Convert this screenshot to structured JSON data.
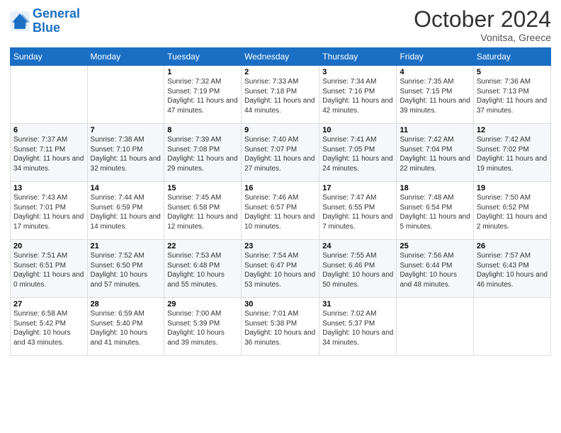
{
  "logo": {
    "text_general": "General",
    "text_blue": "Blue"
  },
  "header": {
    "month": "October 2024",
    "location": "Vonitsa, Greece"
  },
  "weekdays": [
    "Sunday",
    "Monday",
    "Tuesday",
    "Wednesday",
    "Thursday",
    "Friday",
    "Saturday"
  ],
  "weeks": [
    [
      {
        "day": "",
        "sunrise": "",
        "sunset": "",
        "daylight": ""
      },
      {
        "day": "",
        "sunrise": "",
        "sunset": "",
        "daylight": ""
      },
      {
        "day": "1",
        "sunrise": "Sunrise: 7:32 AM",
        "sunset": "Sunset: 7:19 PM",
        "daylight": "Daylight: 11 hours and 47 minutes."
      },
      {
        "day": "2",
        "sunrise": "Sunrise: 7:33 AM",
        "sunset": "Sunset: 7:18 PM",
        "daylight": "Daylight: 11 hours and 44 minutes."
      },
      {
        "day": "3",
        "sunrise": "Sunrise: 7:34 AM",
        "sunset": "Sunset: 7:16 PM",
        "daylight": "Daylight: 11 hours and 42 minutes."
      },
      {
        "day": "4",
        "sunrise": "Sunrise: 7:35 AM",
        "sunset": "Sunset: 7:15 PM",
        "daylight": "Daylight: 11 hours and 39 minutes."
      },
      {
        "day": "5",
        "sunrise": "Sunrise: 7:36 AM",
        "sunset": "Sunset: 7:13 PM",
        "daylight": "Daylight: 11 hours and 37 minutes."
      }
    ],
    [
      {
        "day": "6",
        "sunrise": "Sunrise: 7:37 AM",
        "sunset": "Sunset: 7:11 PM",
        "daylight": "Daylight: 11 hours and 34 minutes."
      },
      {
        "day": "7",
        "sunrise": "Sunrise: 7:38 AM",
        "sunset": "Sunset: 7:10 PM",
        "daylight": "Daylight: 11 hours and 32 minutes."
      },
      {
        "day": "8",
        "sunrise": "Sunrise: 7:39 AM",
        "sunset": "Sunset: 7:08 PM",
        "daylight": "Daylight: 11 hours and 29 minutes."
      },
      {
        "day": "9",
        "sunrise": "Sunrise: 7:40 AM",
        "sunset": "Sunset: 7:07 PM",
        "daylight": "Daylight: 11 hours and 27 minutes."
      },
      {
        "day": "10",
        "sunrise": "Sunrise: 7:41 AM",
        "sunset": "Sunset: 7:05 PM",
        "daylight": "Daylight: 11 hours and 24 minutes."
      },
      {
        "day": "11",
        "sunrise": "Sunrise: 7:42 AM",
        "sunset": "Sunset: 7:04 PM",
        "daylight": "Daylight: 11 hours and 22 minutes."
      },
      {
        "day": "12",
        "sunrise": "Sunrise: 7:42 AM",
        "sunset": "Sunset: 7:02 PM",
        "daylight": "Daylight: 11 hours and 19 minutes."
      }
    ],
    [
      {
        "day": "13",
        "sunrise": "Sunrise: 7:43 AM",
        "sunset": "Sunset: 7:01 PM",
        "daylight": "Daylight: 11 hours and 17 minutes."
      },
      {
        "day": "14",
        "sunrise": "Sunrise: 7:44 AM",
        "sunset": "Sunset: 6:59 PM",
        "daylight": "Daylight: 11 hours and 14 minutes."
      },
      {
        "day": "15",
        "sunrise": "Sunrise: 7:45 AM",
        "sunset": "Sunset: 6:58 PM",
        "daylight": "Daylight: 11 hours and 12 minutes."
      },
      {
        "day": "16",
        "sunrise": "Sunrise: 7:46 AM",
        "sunset": "Sunset: 6:57 PM",
        "daylight": "Daylight: 11 hours and 10 minutes."
      },
      {
        "day": "17",
        "sunrise": "Sunrise: 7:47 AM",
        "sunset": "Sunset: 6:55 PM",
        "daylight": "Daylight: 11 hours and 7 minutes."
      },
      {
        "day": "18",
        "sunrise": "Sunrise: 7:48 AM",
        "sunset": "Sunset: 6:54 PM",
        "daylight": "Daylight: 11 hours and 5 minutes."
      },
      {
        "day": "19",
        "sunrise": "Sunrise: 7:50 AM",
        "sunset": "Sunset: 6:52 PM",
        "daylight": "Daylight: 11 hours and 2 minutes."
      }
    ],
    [
      {
        "day": "20",
        "sunrise": "Sunrise: 7:51 AM",
        "sunset": "Sunset: 6:51 PM",
        "daylight": "Daylight: 11 hours and 0 minutes."
      },
      {
        "day": "21",
        "sunrise": "Sunrise: 7:52 AM",
        "sunset": "Sunset: 6:50 PM",
        "daylight": "Daylight: 10 hours and 57 minutes."
      },
      {
        "day": "22",
        "sunrise": "Sunrise: 7:53 AM",
        "sunset": "Sunset: 6:48 PM",
        "daylight": "Daylight: 10 hours and 55 minutes."
      },
      {
        "day": "23",
        "sunrise": "Sunrise: 7:54 AM",
        "sunset": "Sunset: 6:47 PM",
        "daylight": "Daylight: 10 hours and 53 minutes."
      },
      {
        "day": "24",
        "sunrise": "Sunrise: 7:55 AM",
        "sunset": "Sunset: 6:46 PM",
        "daylight": "Daylight: 10 hours and 50 minutes."
      },
      {
        "day": "25",
        "sunrise": "Sunrise: 7:56 AM",
        "sunset": "Sunset: 6:44 PM",
        "daylight": "Daylight: 10 hours and 48 minutes."
      },
      {
        "day": "26",
        "sunrise": "Sunrise: 7:57 AM",
        "sunset": "Sunset: 6:43 PM",
        "daylight": "Daylight: 10 hours and 46 minutes."
      }
    ],
    [
      {
        "day": "27",
        "sunrise": "Sunrise: 6:58 AM",
        "sunset": "Sunset: 5:42 PM",
        "daylight": "Daylight: 10 hours and 43 minutes."
      },
      {
        "day": "28",
        "sunrise": "Sunrise: 6:59 AM",
        "sunset": "Sunset: 5:40 PM",
        "daylight": "Daylight: 10 hours and 41 minutes."
      },
      {
        "day": "29",
        "sunrise": "Sunrise: 7:00 AM",
        "sunset": "Sunset: 5:39 PM",
        "daylight": "Daylight: 10 hours and 39 minutes."
      },
      {
        "day": "30",
        "sunrise": "Sunrise: 7:01 AM",
        "sunset": "Sunset: 5:38 PM",
        "daylight": "Daylight: 10 hours and 36 minutes."
      },
      {
        "day": "31",
        "sunrise": "Sunrise: 7:02 AM",
        "sunset": "Sunset: 5:37 PM",
        "daylight": "Daylight: 10 hours and 34 minutes."
      },
      {
        "day": "",
        "sunrise": "",
        "sunset": "",
        "daylight": ""
      },
      {
        "day": "",
        "sunrise": "",
        "sunset": "",
        "daylight": ""
      }
    ]
  ]
}
